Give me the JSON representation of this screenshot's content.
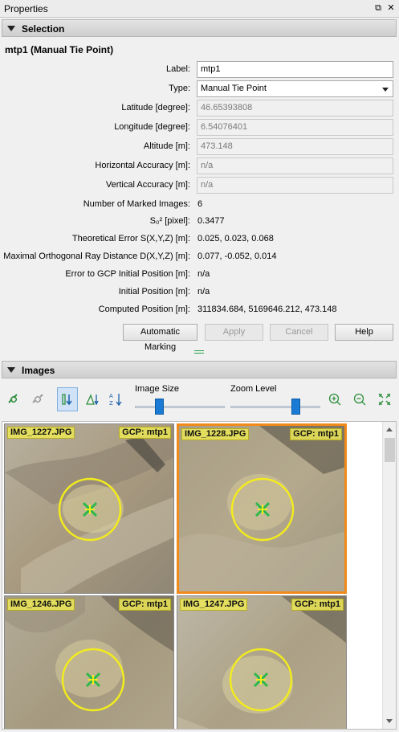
{
  "window": {
    "title": "Properties",
    "float_icon": "⧉",
    "close_icon": "✕"
  },
  "selection": {
    "header": "Selection",
    "title": "mtp1 (Manual Tie Point)",
    "fields": {
      "label": {
        "label": "Label:",
        "value": "mtp1"
      },
      "type": {
        "label": "Type:",
        "value": "Manual Tie Point"
      },
      "latitude": {
        "label": "Latitude [degree]:",
        "value": "46.65393808"
      },
      "longitude": {
        "label": "Longitude [degree]:",
        "value": "6.54076401"
      },
      "altitude": {
        "label": "Altitude [m]:",
        "value": "473.148"
      },
      "horiz_acc": {
        "label": "Horizontal Accuracy [m]:",
        "value": "n/a"
      },
      "vert_acc": {
        "label": "Vertical Accuracy [m]:",
        "value": "n/a"
      }
    },
    "stats": {
      "marked_images": {
        "label": "Number of Marked Images:",
        "value": "6"
      },
      "s0": {
        "label": "S₀² [pixel]:",
        "value": "0.3477"
      },
      "theo_error": {
        "label": "Theoretical Error S(X,Y,Z) [m]:",
        "value": "0.025, 0.023, 0.068"
      },
      "max_ray": {
        "label": "Maximal Orthogonal Ray Distance D(X,Y,Z) [m]:",
        "value": "0.077, -0.052, 0.014"
      },
      "gcp_error": {
        "label": "Error to GCP Initial Position [m]:",
        "value": "n/a"
      },
      "initial_pos": {
        "label": "Initial Position [m]:",
        "value": "n/a"
      },
      "computed_pos": {
        "label": "Computed Position [m]:",
        "value": "311834.684, 5169646.212, 473.148"
      }
    },
    "buttons": {
      "auto_marking": "Automatic Marking",
      "apply": "Apply",
      "cancel": "Cancel",
      "help": "Help"
    }
  },
  "images": {
    "header": "Images",
    "image_size_label": "Image Size",
    "image_size_level": 0.25,
    "zoom_level_label": "Zoom Level",
    "zoom_level_level": 0.75,
    "tools": [
      "link-icon",
      "unlink-icon",
      "sort-descending-icon",
      "sort-error-icon",
      "sort-alpha-icon",
      "zoom-in-icon",
      "zoom-out-icon",
      "fit-icon"
    ],
    "thumbs": [
      {
        "name": "IMG_1227.JPG",
        "gcp": "GCP: mtp1",
        "selected": false
      },
      {
        "name": "IMG_1228.JPG",
        "gcp": "GCP: mtp1",
        "selected": true
      },
      {
        "name": "IMG_1246.JPG",
        "gcp": "GCP: mtp1",
        "selected": false
      },
      {
        "name": "IMG_1247.JPG",
        "gcp": "GCP: mtp1",
        "selected": false
      }
    ]
  }
}
